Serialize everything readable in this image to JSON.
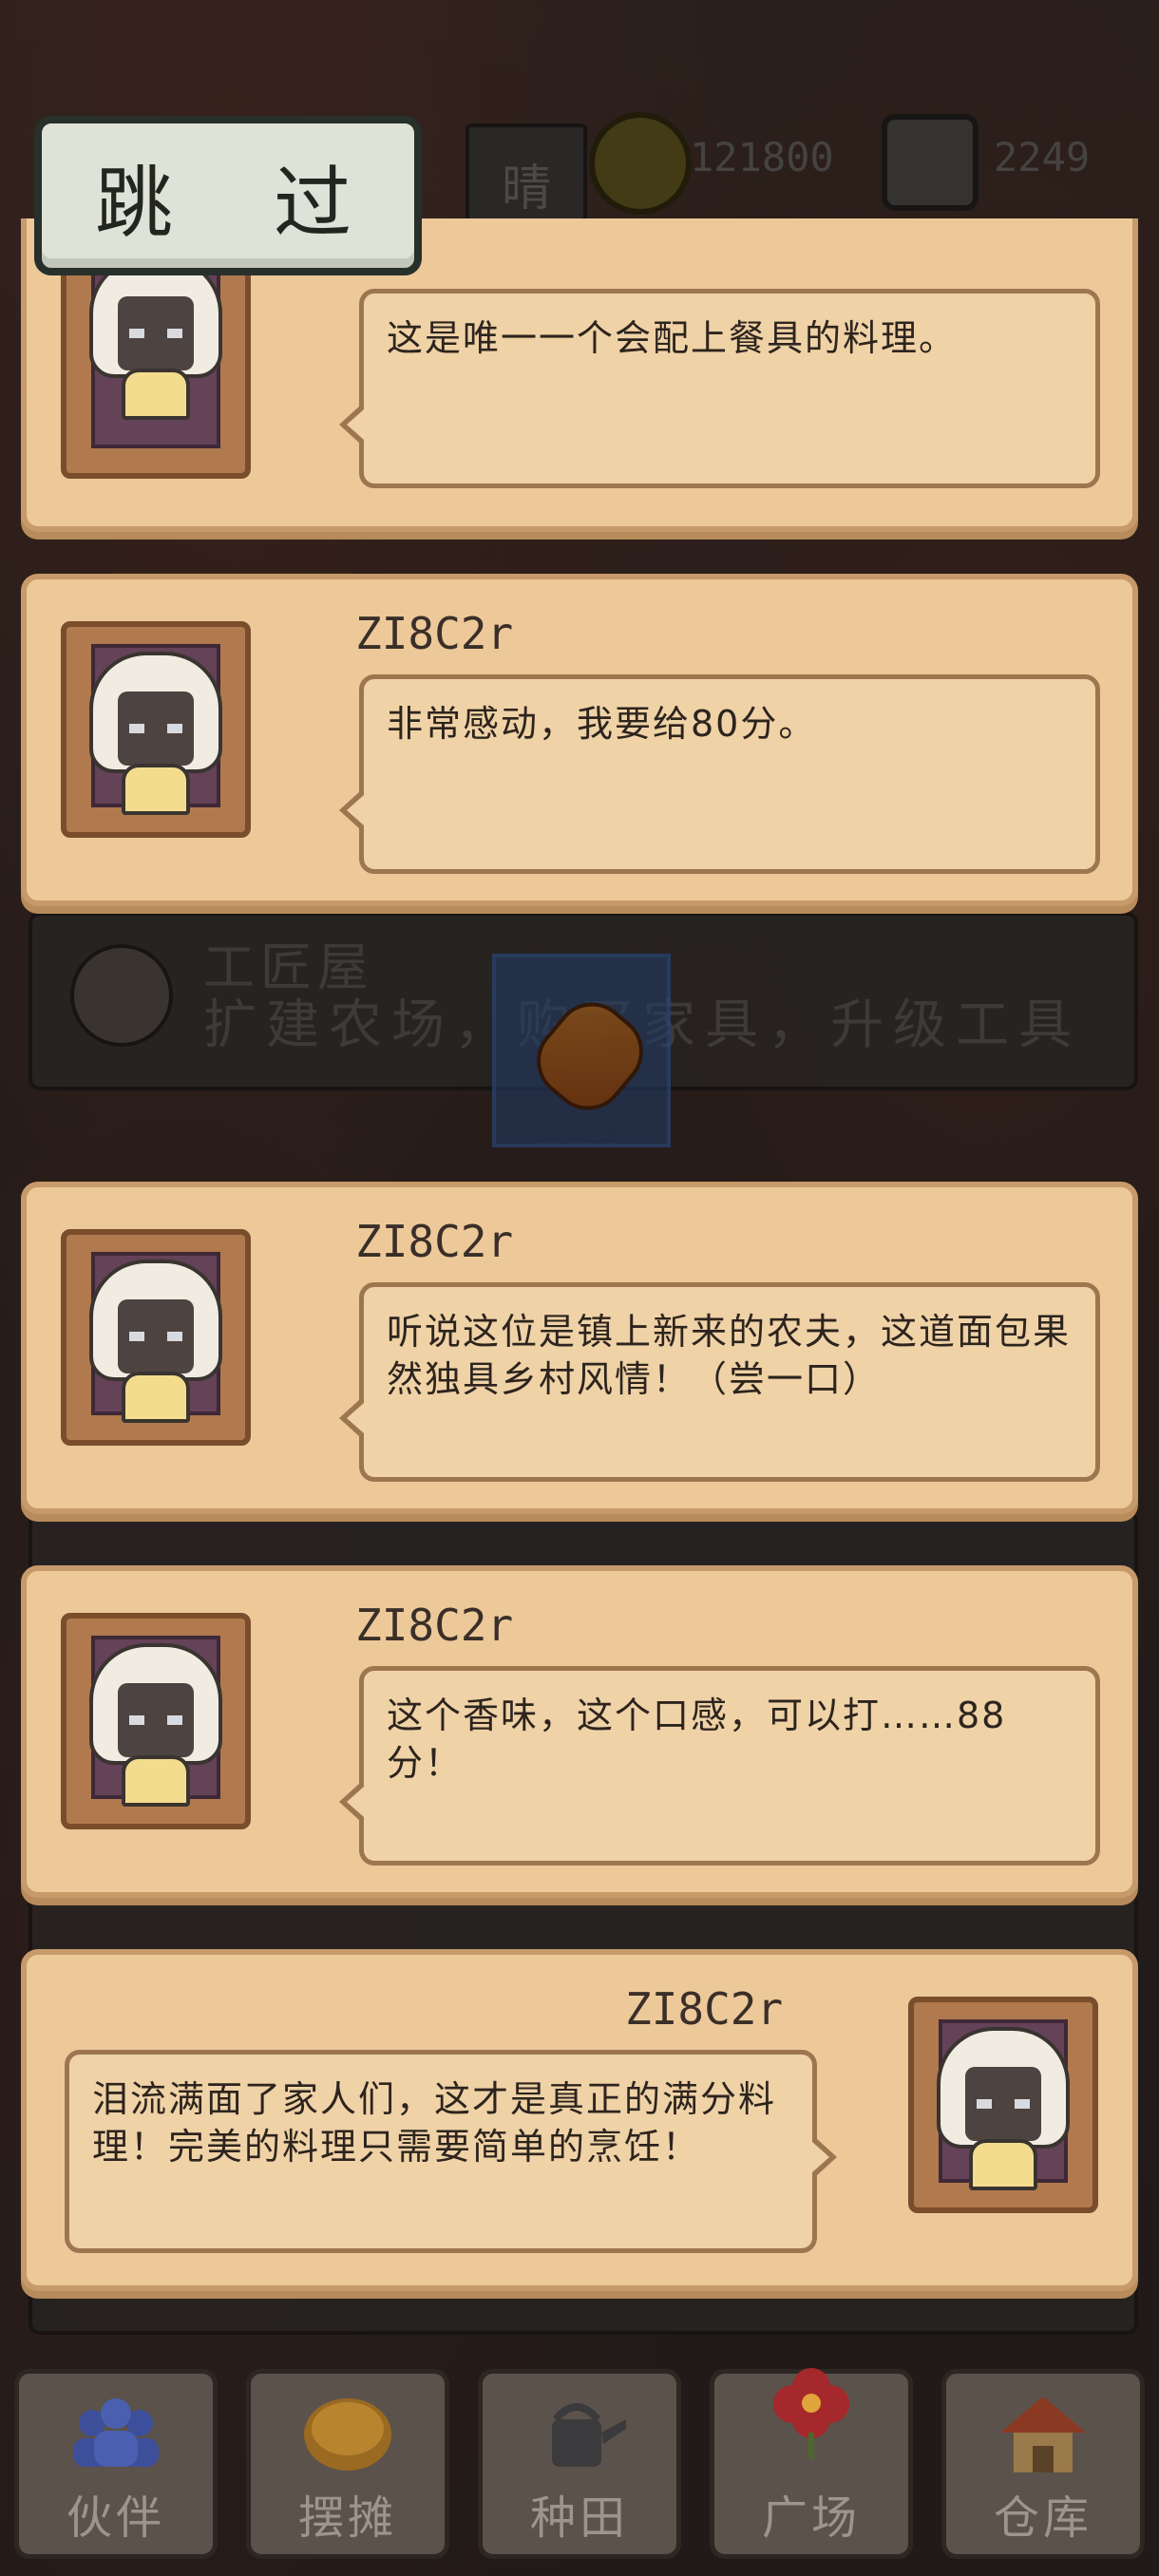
{
  "skip_button": {
    "label": "跳 过"
  },
  "hud": {
    "weather": "晴",
    "coins": "121800",
    "tokens": "2249"
  },
  "background": {
    "workshop_title": "工匠屋",
    "workshop_desc": "扩建农场，购买家具，升级工具"
  },
  "dialogs": [
    {
      "name": "",
      "text": "这是唯一一个会配上餐具的料理。"
    },
    {
      "name": "ZI8C2r",
      "text": "非常感动，我要给80分。"
    },
    {
      "name": "ZI8C2r",
      "text": "听说这位是镇上新来的农夫，这道面包果然独具乡村风情！（尝一口）"
    },
    {
      "name": "ZI8C2r",
      "text": "这个香味，这个口感，可以打……88分！"
    },
    {
      "name": "ZI8C2r",
      "text": "泪流满面了家人们，这才是真正的满分料理！完美的料理只需要简单的烹饪！"
    }
  ],
  "nav": [
    {
      "label": "伙伴",
      "icon": "people-icon"
    },
    {
      "label": "摆摊",
      "icon": "stall-icon"
    },
    {
      "label": "种田",
      "icon": "watering-can-icon"
    },
    {
      "label": "广场",
      "icon": "flower-icon"
    },
    {
      "label": "仓库",
      "icon": "warehouse-icon"
    }
  ],
  "colors": {
    "card": "#edc99a",
    "bubble": "#efd2a6",
    "frame": "#b07a4e",
    "skip": "#dfe2d6"
  }
}
